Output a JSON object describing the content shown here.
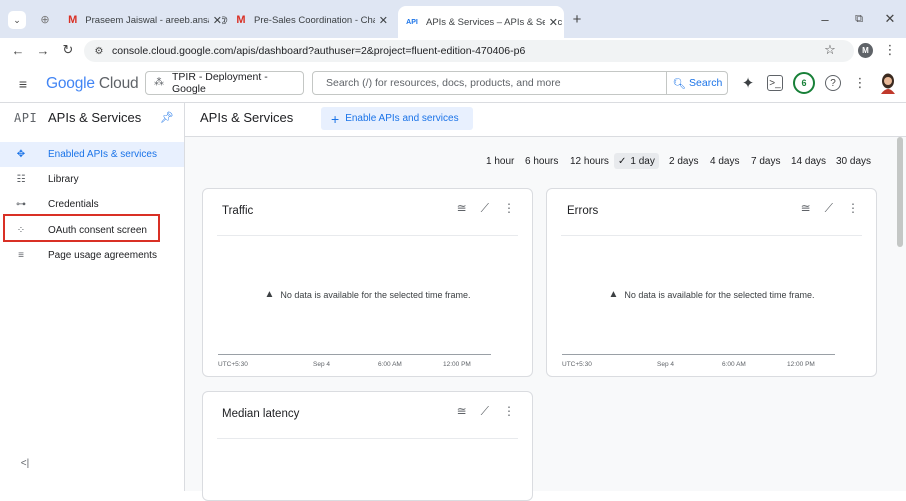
{
  "browser": {
    "tabs": [
      {
        "label": "Praseem Jaiswal - areeb.ansari@",
        "favicon": "gmail-icon"
      },
      {
        "label": "Pre-Sales Coordination - Chat",
        "favicon": "gmail-icon"
      },
      {
        "label": "APIs & Services – APIs & Servic",
        "favicon": "api-icon",
        "active": true
      }
    ],
    "url": "console.cloud.google.com/apis/dashboard?authuser=2&project=fluent-edition-470406-p6",
    "profile_initial": "M"
  },
  "gcp": {
    "logo_google": "Google",
    "logo_cloud": "Cloud",
    "project": "TPIR - Deployment - Google",
    "search_placeholder": "Search (/) for resources, docs, products, and more",
    "search_button": "Search",
    "notifications_count": "6"
  },
  "sidebar": {
    "badge": "API",
    "title": "APIs & Services",
    "items": [
      {
        "label": "Enabled APIs & services",
        "icon": "diamond-icon",
        "active": true
      },
      {
        "label": "Library",
        "icon": "library-icon"
      },
      {
        "label": "Credentials",
        "icon": "key-icon"
      },
      {
        "label": "OAuth consent screen",
        "icon": "consent-icon"
      },
      {
        "label": "Page usage agreements",
        "icon": "agreements-icon"
      }
    ]
  },
  "main": {
    "title": "APIs & Services",
    "enable_button": "Enable APIs and services",
    "time_ranges": [
      "1 hour",
      "6 hours",
      "12 hours",
      "1 day",
      "2 days",
      "4 days",
      "7 days",
      "14 days",
      "30 days"
    ],
    "selected_range": "1 day",
    "cards": [
      {
        "title": "Traffic",
        "no_data": "No data is available for the selected time frame.",
        "ticks": [
          "UTC+5:30",
          "Sep 4",
          "6:00 AM",
          "12:00 PM"
        ]
      },
      {
        "title": "Errors",
        "no_data": "No data is available for the selected time frame.",
        "ticks": [
          "UTC+5:30",
          "Sep 4",
          "6:00 AM",
          "12:00 PM"
        ]
      },
      {
        "title": "Median latency"
      }
    ]
  },
  "colors": {
    "accent": "#1a73e8",
    "highlight": "#d93025"
  }
}
